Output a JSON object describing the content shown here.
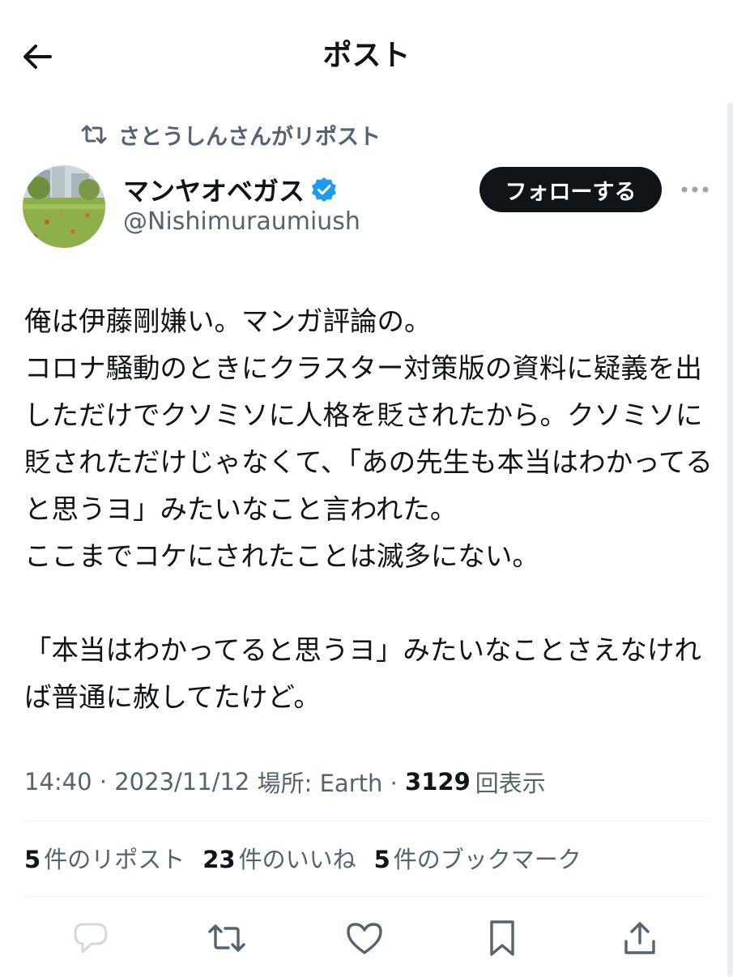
{
  "header": {
    "title": "ポスト"
  },
  "repost": {
    "text": "さとうしんさんがリポスト"
  },
  "author": {
    "name": "マンヤオベガス",
    "handle": "@Nishimuraumiush",
    "verified_color": "#1d9bf0"
  },
  "follow": {
    "label": "フォローする"
  },
  "tweet": {
    "text": "俺は伊藤剛嫌い。マンガ評論の。\nコロナ騒動のときにクラスター対策版の資料に疑義を出しただけでクソミソに人格を貶されたから。クソミソに貶されただけじゃなくて、「あの先生も本当はわかってると思うヨ」みたいなこと言われた。\nここまでコケにされたことは滅多にない。\n\n「本当はわかってると思うヨ」みたいなことさえなければ普通に赦してたけど。"
  },
  "meta": {
    "time": "14:40",
    "sep": " · ",
    "date": "2023/11/12",
    "location": " 場所: Earth · ",
    "views_count": "3129",
    "views_label": "回表示"
  },
  "stats": {
    "reposts_count": "5",
    "reposts_label": "件のリポスト",
    "likes_count": "23",
    "likes_label": "件のいいね",
    "bookmarks_count": "5",
    "bookmarks_label": "件のブックマーク"
  },
  "colors": {
    "text": "#0f1419",
    "muted": "#536471",
    "verified": "#1d9bf0",
    "reply_icon": "#cfd9de"
  },
  "icons": [
    "back-arrow-icon",
    "repost-icon",
    "verified-badge-icon",
    "more-icon",
    "reply-icon",
    "retweet-icon",
    "like-icon",
    "bookmark-icon",
    "share-icon"
  ]
}
